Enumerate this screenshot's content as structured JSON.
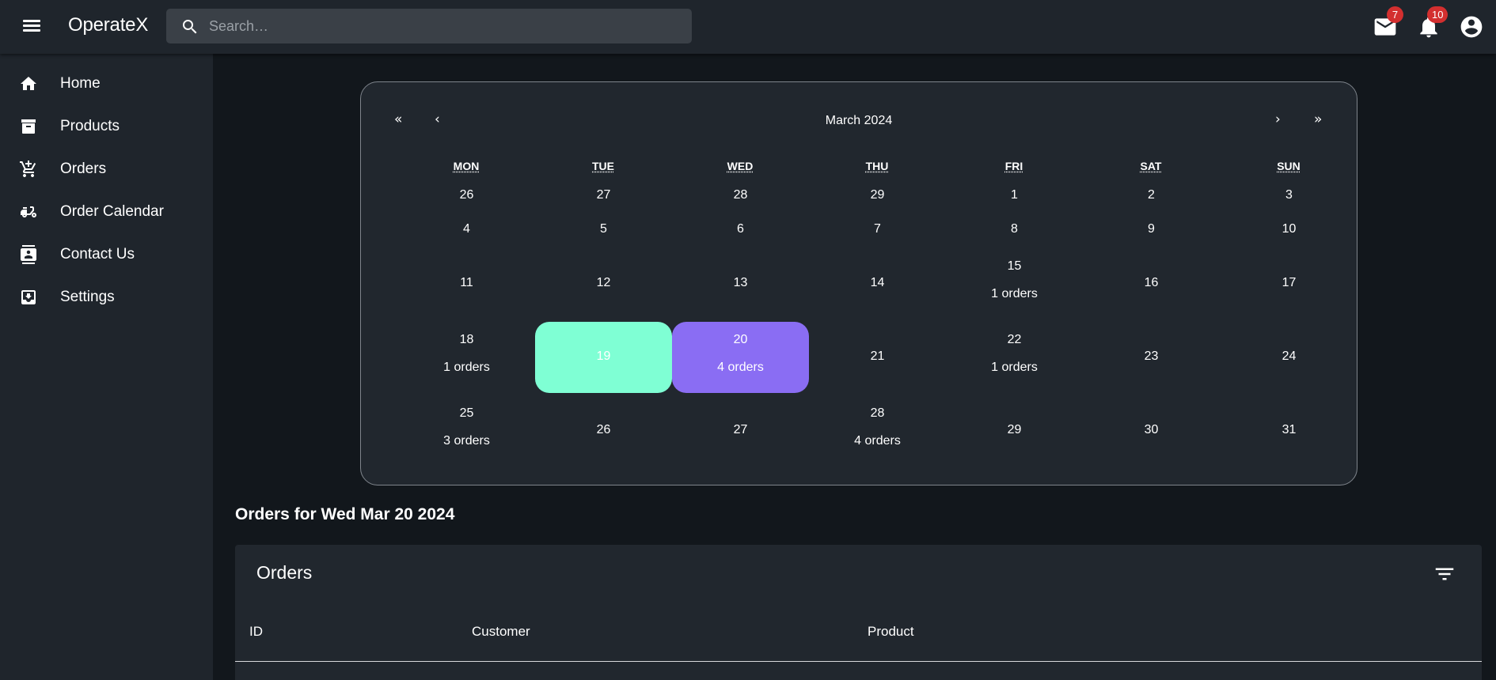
{
  "app": {
    "brand": "OperateX",
    "search_placeholder": "Search…",
    "mail_badge": "7",
    "notifications_badge": "10"
  },
  "sidebar": {
    "items": [
      {
        "label": "Home",
        "icon": "home-icon"
      },
      {
        "label": "Products",
        "icon": "archive-icon"
      },
      {
        "label": "Orders",
        "icon": "cart-icon"
      },
      {
        "label": "Order Calendar",
        "icon": "delivery-icon"
      },
      {
        "label": "Contact Us",
        "icon": "contact-icon"
      },
      {
        "label": "Settings",
        "icon": "inbox-download-icon"
      }
    ]
  },
  "calendar": {
    "month_label": "March 2024",
    "nav": {
      "prev_year": "«",
      "prev_month": "‹",
      "next_month": "›",
      "next_year": "»"
    },
    "weekdays": [
      "MON",
      "TUE",
      "WED",
      "THU",
      "FRI",
      "SAT",
      "SUN"
    ],
    "weeks": [
      [
        {
          "day": "26"
        },
        {
          "day": "27"
        },
        {
          "day": "28"
        },
        {
          "day": "29"
        },
        {
          "day": "1"
        },
        {
          "day": "2"
        },
        {
          "day": "3"
        }
      ],
      [
        {
          "day": "4"
        },
        {
          "day": "5"
        },
        {
          "day": "6"
        },
        {
          "day": "7"
        },
        {
          "day": "8"
        },
        {
          "day": "9"
        },
        {
          "day": "10"
        }
      ],
      [
        {
          "day": "11"
        },
        {
          "day": "12"
        },
        {
          "day": "13"
        },
        {
          "day": "14"
        },
        {
          "day": "15",
          "orders": "1 orders"
        },
        {
          "day": "16"
        },
        {
          "day": "17"
        }
      ],
      [
        {
          "day": "18",
          "orders": "1 orders"
        },
        {
          "day": "19",
          "state": "today"
        },
        {
          "day": "20",
          "orders": "4 orders",
          "state": "selected"
        },
        {
          "day": "21"
        },
        {
          "day": "22",
          "orders": "1 orders"
        },
        {
          "day": "23"
        },
        {
          "day": "24"
        }
      ],
      [
        {
          "day": "25",
          "orders": "3 orders"
        },
        {
          "day": "26"
        },
        {
          "day": "27"
        },
        {
          "day": "28",
          "orders": "4 orders"
        },
        {
          "day": "29"
        },
        {
          "day": "30"
        },
        {
          "day": "31"
        }
      ]
    ],
    "colors": {
      "today": "#7fffd4",
      "selected": "#8a6df3"
    }
  },
  "orders_section": {
    "heading": "Orders for Wed Mar 20 2024",
    "table_title": "Orders",
    "columns": [
      "ID",
      "Customer",
      "Product"
    ]
  }
}
